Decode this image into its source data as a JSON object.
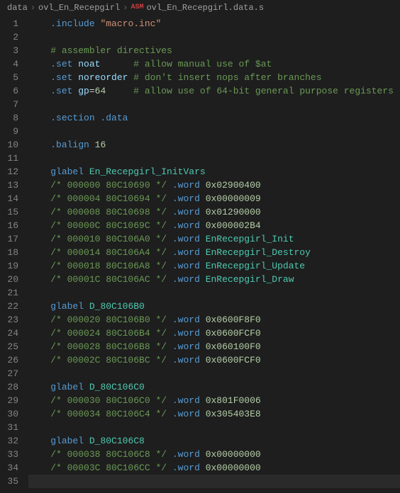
{
  "breadcrumb": {
    "folder1": "data",
    "folder2": "ovl_En_Recepgirl",
    "icon_label": "ASM",
    "file": "ovl_En_Recepgirl.data.s"
  },
  "lines": [
    {
      "n": 1,
      "tokens": [
        [
          "plain",
          "    "
        ],
        [
          "directive",
          ".include"
        ],
        [
          "plain",
          " "
        ],
        [
          "string",
          "\"macro.inc\""
        ]
      ]
    },
    {
      "n": 2,
      "tokens": []
    },
    {
      "n": 3,
      "tokens": [
        [
          "plain",
          "    "
        ],
        [
          "comment",
          "# assembler directives"
        ]
      ]
    },
    {
      "n": 4,
      "tokens": [
        [
          "plain",
          "    "
        ],
        [
          "directive",
          ".set"
        ],
        [
          "plain",
          " "
        ],
        [
          "ident",
          "noat"
        ],
        [
          "plain",
          "      "
        ],
        [
          "comment",
          "# allow manual use of $at"
        ]
      ]
    },
    {
      "n": 5,
      "tokens": [
        [
          "plain",
          "    "
        ],
        [
          "directive",
          ".set"
        ],
        [
          "plain",
          " "
        ],
        [
          "ident",
          "noreorder"
        ],
        [
          "plain",
          " "
        ],
        [
          "comment",
          "# don't insert nops after branches"
        ]
      ]
    },
    {
      "n": 6,
      "tokens": [
        [
          "plain",
          "    "
        ],
        [
          "directive",
          ".set"
        ],
        [
          "plain",
          " "
        ],
        [
          "ident",
          "gp"
        ],
        [
          "plain",
          "="
        ],
        [
          "number",
          "64"
        ],
        [
          "plain",
          "     "
        ],
        [
          "comment",
          "# allow use of 64-bit general purpose registers"
        ]
      ]
    },
    {
      "n": 7,
      "tokens": []
    },
    {
      "n": 8,
      "tokens": [
        [
          "plain",
          "    "
        ],
        [
          "directive",
          ".section"
        ],
        [
          "plain",
          " "
        ],
        [
          "directive",
          ".data"
        ]
      ]
    },
    {
      "n": 9,
      "tokens": []
    },
    {
      "n": 10,
      "tokens": [
        [
          "plain",
          "    "
        ],
        [
          "directive",
          ".balign"
        ],
        [
          "plain",
          " "
        ],
        [
          "number",
          "16"
        ]
      ]
    },
    {
      "n": 11,
      "tokens": []
    },
    {
      "n": 12,
      "tokens": [
        [
          "plain",
          "    "
        ],
        [
          "opcode",
          "glabel"
        ],
        [
          "plain",
          " "
        ],
        [
          "label",
          "En_Recepgirl_InitVars"
        ]
      ]
    },
    {
      "n": 13,
      "tokens": [
        [
          "plain",
          "    "
        ],
        [
          "comment",
          "/* 000000 80C10690 */"
        ],
        [
          "plain",
          " "
        ],
        [
          "directive",
          ".word"
        ],
        [
          "plain",
          " "
        ],
        [
          "number",
          "0x02900400"
        ]
      ]
    },
    {
      "n": 14,
      "tokens": [
        [
          "plain",
          "    "
        ],
        [
          "comment",
          "/* 000004 80C10694 */"
        ],
        [
          "plain",
          " "
        ],
        [
          "directive",
          ".word"
        ],
        [
          "plain",
          " "
        ],
        [
          "number",
          "0x00000009"
        ]
      ]
    },
    {
      "n": 15,
      "tokens": [
        [
          "plain",
          "    "
        ],
        [
          "comment",
          "/* 000008 80C10698 */"
        ],
        [
          "plain",
          " "
        ],
        [
          "directive",
          ".word"
        ],
        [
          "plain",
          " "
        ],
        [
          "number",
          "0x01290000"
        ]
      ]
    },
    {
      "n": 16,
      "tokens": [
        [
          "plain",
          "    "
        ],
        [
          "comment",
          "/* 00000C 80C1069C */"
        ],
        [
          "plain",
          " "
        ],
        [
          "directive",
          ".word"
        ],
        [
          "plain",
          " "
        ],
        [
          "number",
          "0x000002B4"
        ]
      ]
    },
    {
      "n": 17,
      "tokens": [
        [
          "plain",
          "    "
        ],
        [
          "comment",
          "/* 000010 80C106A0 */"
        ],
        [
          "plain",
          " "
        ],
        [
          "directive",
          ".word"
        ],
        [
          "plain",
          " "
        ],
        [
          "label",
          "EnRecepgirl_Init"
        ]
      ]
    },
    {
      "n": 18,
      "tokens": [
        [
          "plain",
          "    "
        ],
        [
          "comment",
          "/* 000014 80C106A4 */"
        ],
        [
          "plain",
          " "
        ],
        [
          "directive",
          ".word"
        ],
        [
          "plain",
          " "
        ],
        [
          "label",
          "EnRecepgirl_Destroy"
        ]
      ]
    },
    {
      "n": 19,
      "tokens": [
        [
          "plain",
          "    "
        ],
        [
          "comment",
          "/* 000018 80C106A8 */"
        ],
        [
          "plain",
          " "
        ],
        [
          "directive",
          ".word"
        ],
        [
          "plain",
          " "
        ],
        [
          "label",
          "EnRecepgirl_Update"
        ]
      ]
    },
    {
      "n": 20,
      "tokens": [
        [
          "plain",
          "    "
        ],
        [
          "comment",
          "/* 00001C 80C106AC */"
        ],
        [
          "plain",
          " "
        ],
        [
          "directive",
          ".word"
        ],
        [
          "plain",
          " "
        ],
        [
          "label",
          "EnRecepgirl_Draw"
        ]
      ]
    },
    {
      "n": 21,
      "tokens": []
    },
    {
      "n": 22,
      "tokens": [
        [
          "plain",
          "    "
        ],
        [
          "opcode",
          "glabel"
        ],
        [
          "plain",
          " "
        ],
        [
          "label",
          "D_80C106B0"
        ]
      ]
    },
    {
      "n": 23,
      "tokens": [
        [
          "plain",
          "    "
        ],
        [
          "comment",
          "/* 000020 80C106B0 */"
        ],
        [
          "plain",
          " "
        ],
        [
          "directive",
          ".word"
        ],
        [
          "plain",
          " "
        ],
        [
          "number",
          "0x0600F8F0"
        ]
      ]
    },
    {
      "n": 24,
      "tokens": [
        [
          "plain",
          "    "
        ],
        [
          "comment",
          "/* 000024 80C106B4 */"
        ],
        [
          "plain",
          " "
        ],
        [
          "directive",
          ".word"
        ],
        [
          "plain",
          " "
        ],
        [
          "number",
          "0x0600FCF0"
        ]
      ]
    },
    {
      "n": 25,
      "tokens": [
        [
          "plain",
          "    "
        ],
        [
          "comment",
          "/* 000028 80C106B8 */"
        ],
        [
          "plain",
          " "
        ],
        [
          "directive",
          ".word"
        ],
        [
          "plain",
          " "
        ],
        [
          "number",
          "0x060100F0"
        ]
      ]
    },
    {
      "n": 26,
      "tokens": [
        [
          "plain",
          "    "
        ],
        [
          "comment",
          "/* 00002C 80C106BC */"
        ],
        [
          "plain",
          " "
        ],
        [
          "directive",
          ".word"
        ],
        [
          "plain",
          " "
        ],
        [
          "number",
          "0x0600FCF0"
        ]
      ]
    },
    {
      "n": 27,
      "tokens": []
    },
    {
      "n": 28,
      "tokens": [
        [
          "plain",
          "    "
        ],
        [
          "opcode",
          "glabel"
        ],
        [
          "plain",
          " "
        ],
        [
          "label",
          "D_80C106C0"
        ]
      ]
    },
    {
      "n": 29,
      "tokens": [
        [
          "plain",
          "    "
        ],
        [
          "comment",
          "/* 000030 80C106C0 */"
        ],
        [
          "plain",
          " "
        ],
        [
          "directive",
          ".word"
        ],
        [
          "plain",
          " "
        ],
        [
          "number",
          "0x801F0006"
        ]
      ]
    },
    {
      "n": 30,
      "tokens": [
        [
          "plain",
          "    "
        ],
        [
          "comment",
          "/* 000034 80C106C4 */"
        ],
        [
          "plain",
          " "
        ],
        [
          "directive",
          ".word"
        ],
        [
          "plain",
          " "
        ],
        [
          "number",
          "0x305403E8"
        ]
      ]
    },
    {
      "n": 31,
      "tokens": []
    },
    {
      "n": 32,
      "tokens": [
        [
          "plain",
          "    "
        ],
        [
          "opcode",
          "glabel"
        ],
        [
          "plain",
          " "
        ],
        [
          "label",
          "D_80C106C8"
        ]
      ]
    },
    {
      "n": 33,
      "tokens": [
        [
          "plain",
          "    "
        ],
        [
          "comment",
          "/* 000038 80C106C8 */"
        ],
        [
          "plain",
          " "
        ],
        [
          "directive",
          ".word"
        ],
        [
          "plain",
          " "
        ],
        [
          "number",
          "0x00000000"
        ]
      ]
    },
    {
      "n": 34,
      "tokens": [
        [
          "plain",
          "    "
        ],
        [
          "comment",
          "/* 00003C 80C106CC */"
        ],
        [
          "plain",
          " "
        ],
        [
          "directive",
          ".word"
        ],
        [
          "plain",
          " "
        ],
        [
          "number",
          "0x00000000"
        ]
      ]
    },
    {
      "n": 35,
      "tokens": [],
      "current": true
    }
  ]
}
